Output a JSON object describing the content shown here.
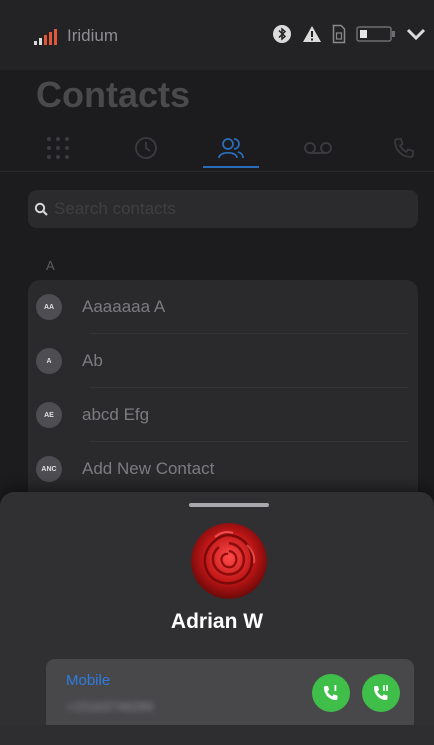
{
  "status_bar": {
    "carrier": "Iridium",
    "icons": [
      "signal-bars-icon",
      "bluetooth-icon",
      "warning-icon",
      "sim-icon",
      "battery-icon",
      "chevron-down-icon"
    ]
  },
  "header": {
    "title": "Contacts"
  },
  "tabs": [
    {
      "icon": "keypad-icon",
      "active": false
    },
    {
      "icon": "clock-icon",
      "active": false
    },
    {
      "icon": "contacts-icon",
      "active": true
    },
    {
      "icon": "voicemail-icon",
      "active": false
    },
    {
      "icon": "phone-icon",
      "active": false
    }
  ],
  "search": {
    "placeholder": "Search contacts",
    "value": ""
  },
  "section": {
    "letter": "A"
  },
  "contacts": [
    {
      "initials": "AA",
      "name": "Aaaaaaa A"
    },
    {
      "initials": "A",
      "name": "Ab"
    },
    {
      "initials": "AE",
      "name": "abcd Efg"
    },
    {
      "initials": "ANC",
      "name": "Add New Contact"
    }
  ],
  "sheet": {
    "contact_name": "Adrian W",
    "phone_label": "Mobile",
    "phone_number": "+15163746289",
    "call_buttons": [
      "call-line-1-icon",
      "call-line-2-icon"
    ]
  },
  "colors": {
    "accent": "#2b6cb8",
    "call_green": "#3fbf4a",
    "background": "#1c1c1e",
    "sheet": "#303033"
  }
}
